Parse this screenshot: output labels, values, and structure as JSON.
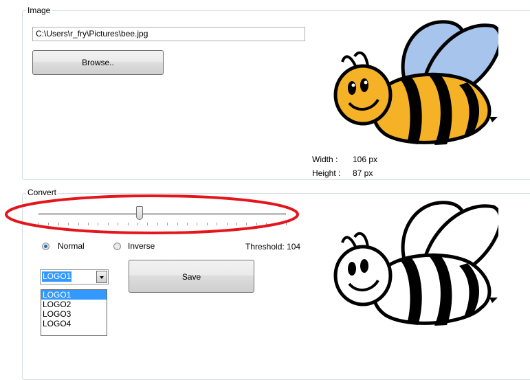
{
  "image_group": {
    "title": "Image",
    "path_value": "C:\\Users\\r_fry\\Pictures\\bee.jpg",
    "browse_label": "Browse..",
    "width_label": "Width :",
    "width_value": "106 px",
    "height_label": "Height :",
    "height_value": "87 px"
  },
  "convert_group": {
    "title": "Convert",
    "slider_value": 104,
    "slider_max": 255,
    "mode_normal": "Normal",
    "mode_inverse": "Inverse",
    "selected_mode": "Normal",
    "threshold_text": "Threshold: 104",
    "save_label": "Save",
    "logo_selected": "LOGO1",
    "logo_options": [
      "LOGO1",
      "LOGO2",
      "LOGO3",
      "LOGO4"
    ]
  },
  "colors": {
    "annotation_ellipse": "#e3161d",
    "bee_yellow": "#f6b226",
    "bee_wing": "#a6c4ec",
    "selection": "#3399ff"
  }
}
